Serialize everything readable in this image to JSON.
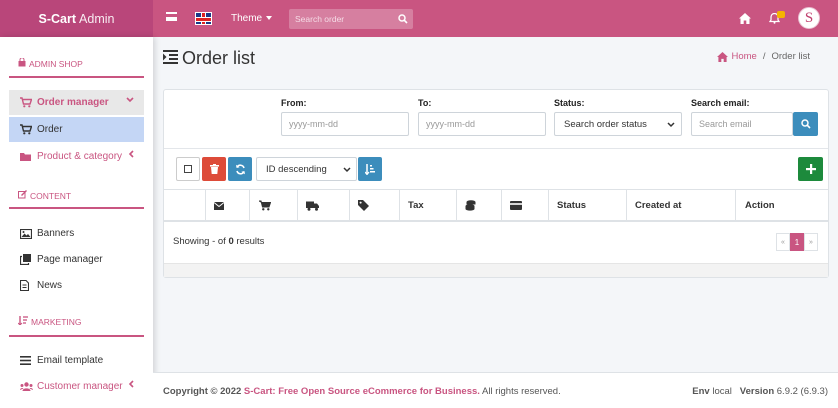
{
  "topbar": {
    "brand_bold": "S-Cart",
    "brand_light": "Admin",
    "theme_label": "Theme",
    "search_placeholder": "Search order",
    "avatar_letter": "S",
    "accent_color": "#c95581"
  },
  "sidebar": {
    "sections": [
      {
        "title": "ADMIN SHOP",
        "icon": "shop-icon"
      },
      {
        "title": "CONTENT",
        "icon": "edit-icon"
      },
      {
        "title": "MARKETING",
        "icon": "sort-icon"
      }
    ],
    "items": [
      {
        "label": "Order manager",
        "icon": "cart-icon",
        "state": "active-group"
      },
      {
        "label": "Order",
        "icon": "cart-icon",
        "state": "selected"
      },
      {
        "label": "Product & category",
        "icon": "folder-icon",
        "state": "collapsed"
      },
      {
        "label": "Banners",
        "icon": "image-icon"
      },
      {
        "label": "Page manager",
        "icon": "copy-icon"
      },
      {
        "label": "News",
        "icon": "file-icon"
      },
      {
        "label": "Email template",
        "icon": "list-icon"
      },
      {
        "label": "Customer manager",
        "icon": "users-icon",
        "state": "collapsed"
      }
    ]
  },
  "page": {
    "title": "Order list",
    "breadcrumb_home": "Home",
    "breadcrumb_current": "Order list"
  },
  "filters": {
    "from_label": "From:",
    "from_placeholder": "yyyy-mm-dd",
    "to_label": "To:",
    "to_placeholder": "yyyy-mm-dd",
    "status_label": "Status:",
    "status_value": "Search order status",
    "email_label": "Search email:",
    "email_placeholder": "Search email"
  },
  "toolbar": {
    "sort_value": "ID descending"
  },
  "table": {
    "columns": [
      {
        "label": "",
        "icon": "checkbox-col"
      },
      {
        "label": "",
        "icon": "envelope-icon"
      },
      {
        "label": "",
        "icon": "cart-icon"
      },
      {
        "label": "",
        "icon": "truck-icon"
      },
      {
        "label": "",
        "icon": "tags-icon"
      },
      {
        "label": "Tax",
        "icon": ""
      },
      {
        "label": "",
        "icon": "coins-icon"
      },
      {
        "label": "",
        "icon": "credit-card-icon"
      },
      {
        "label": "Status",
        "icon": ""
      },
      {
        "label": "Created at",
        "icon": ""
      },
      {
        "label": "Action",
        "icon": ""
      }
    ],
    "showing_prefix": "Showing - of",
    "total": "0",
    "showing_suffix": "results",
    "pagination": {
      "prev": "«",
      "current": "1",
      "next": "»"
    }
  },
  "footer": {
    "copyright": "Copyright © 2022",
    "brand_text": "S-Cart: Free Open Source eCommerce for Business.",
    "rights": "All rights reserved.",
    "env_label": "Env",
    "env_value": "local",
    "version_label": "Version",
    "version_value": "6.9.2 (6.9.3)"
  }
}
